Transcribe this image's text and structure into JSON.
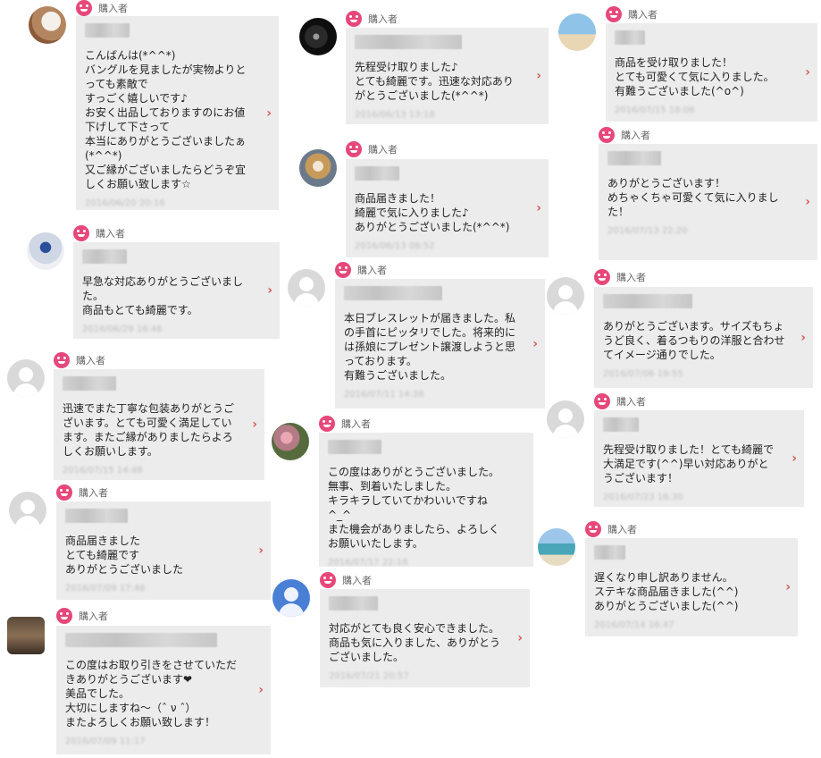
{
  "buyer_label": "購入者",
  "reviews": [
    {
      "message": "こんばんは(*^^*)\nバングルを見ましたが実物よりとっても素敵で\nすっごく嬉しいです♪\nお安く出品しておりますのにお値下げして下さって\n本当にありがとうございましたぁ(*^^*)\n又ご縁がございましたらどうぞ宜しくお願い致します☆",
      "date": "2016/06/20 20:16"
    },
    {
      "message": "先程受け取りました♪\nとても綺麗です。迅速な対応ありがとうございました(*^^*)",
      "date": "2016/06/13 13:18"
    },
    {
      "message": "商品を受け取りました！\nとても可愛くて気に入りました。\n有難うございました(^o^)",
      "date": "2016/07/15 18:06"
    },
    {
      "message": "ありがとうございます！\nめちゃくちゃ可愛くて気に入りました！",
      "date": "2016/07/13 22:20"
    },
    {
      "message": "商品届きました！\n綺麗で気に入りました♪\nありがとうございました(*^^*)",
      "date": "2016/06/13 08:52"
    },
    {
      "message": "早急な対応ありがとうございました。\n商品もとても綺麗です。",
      "date": "2016/06/29 16:46"
    },
    {
      "message": "本日ブレスレットが届きました。私の手首にピッタリでした。将来的には孫娘にプレゼント譲渡しようと思っております。\n有難うございました。",
      "date": "2016/07/11 14:38"
    },
    {
      "message": "ありがとうございます。サイズもちょうど良く、着るつもりの洋服と合わせてイメージ通りでした。",
      "date": "2016/07/06 19:55"
    },
    {
      "message": "迅速でまた丁寧な包装ありがとうございます。とても可愛く満足しています。またご縁がありましたらよろしくお願いします。",
      "date": "2016/07/15 14:48"
    },
    {
      "message": "この度はありがとうございました。\n無事、到着いたしました。\nキラキラしていてかわいいですね^_^\nまた機会がありましたら、よろしくお願いいたします。",
      "date": "2016/07/17 22:16"
    },
    {
      "message": "先程受け取りました！とても綺麗で大満足です(^^)早い対応ありがとうございます！",
      "date": "2016/07/23 16:30"
    },
    {
      "message": "商品届きました\nとても綺麗です\nありがとうございました",
      "date": "2016/07/09 17:46"
    },
    {
      "message": "遅くなり申し訳ありません。\nステキな商品届きました(^^)\nありがとうございました(^^)",
      "date": "2016/07/14 16:47"
    },
    {
      "message": "対応がとても良く安心できました。\n商品も気に入りました、ありがとうございました。",
      "date": "2016/07/21 20:57"
    },
    {
      "message": "この度はお取り引きをさせていただきありがとうございます❤\n美品でした。\n大切にしますね〜（ˆ ν ˆ）\nまたよろしくお願い致します！",
      "date": "2016/07/09 11:17"
    }
  ]
}
